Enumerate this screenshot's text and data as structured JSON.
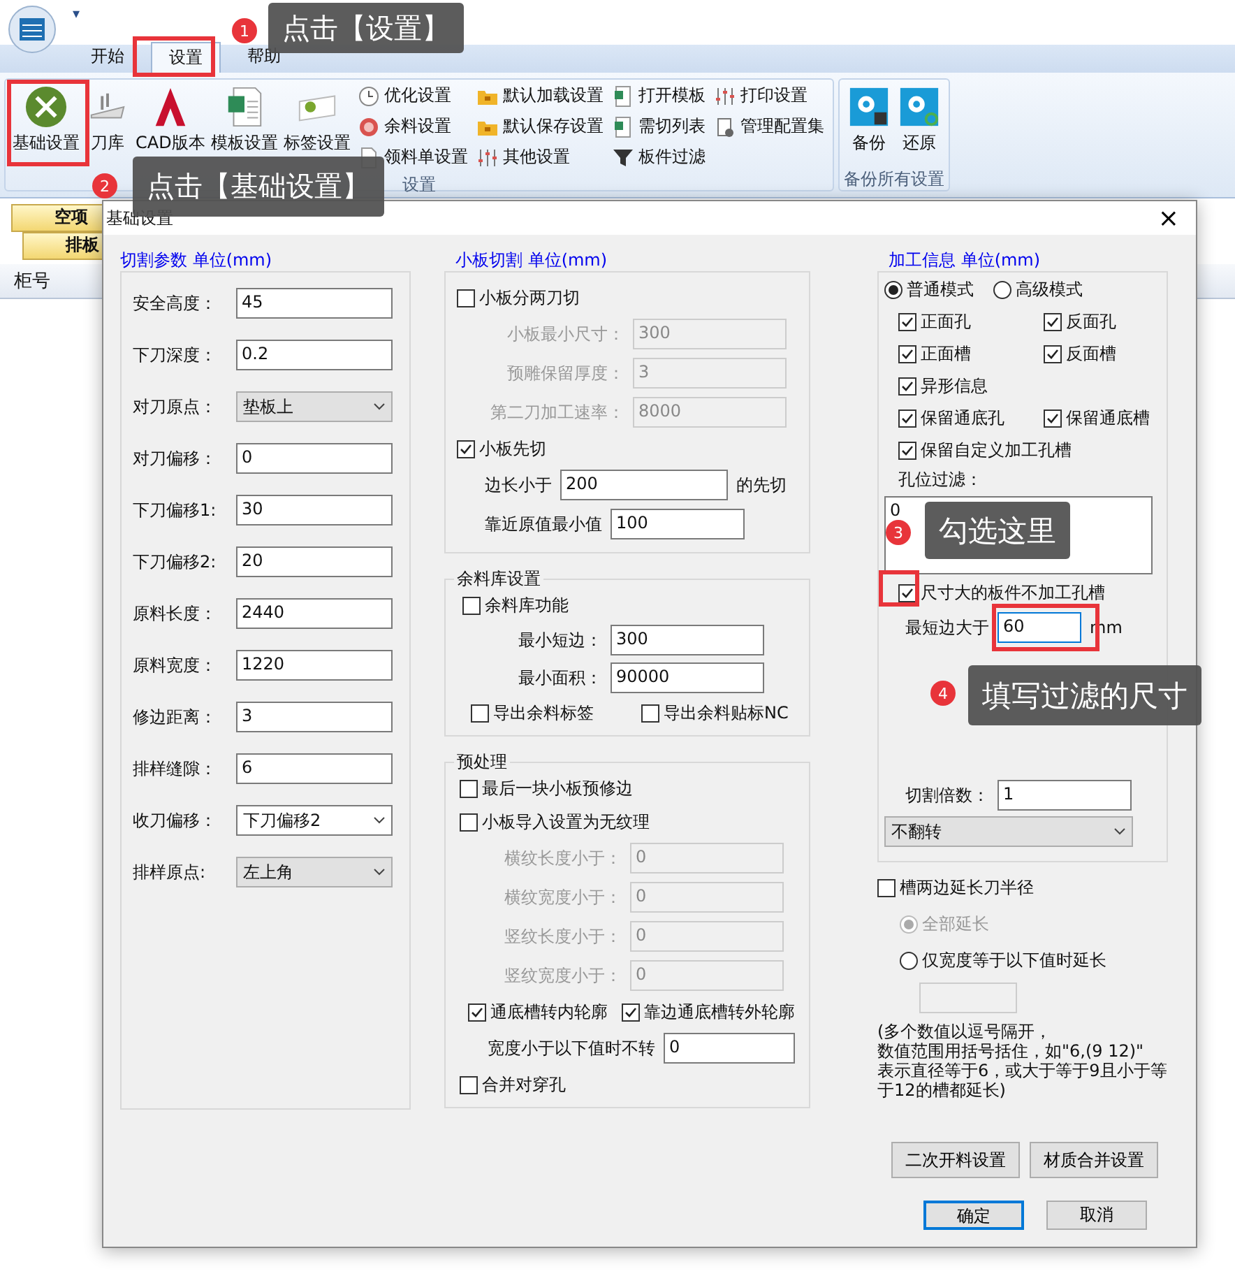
{
  "app": {
    "quick_access": "▾",
    "tabs": [
      {
        "label": "开始",
        "selected": false
      },
      {
        "label": "设置",
        "selected": true
      },
      {
        "label": "帮助",
        "selected": false
      }
    ]
  },
  "ribbon": {
    "large_buttons": [
      {
        "label": "基础设置",
        "kind": "tools"
      },
      {
        "label": "刀库",
        "kind": "knife"
      },
      {
        "label": "CAD版本",
        "kind": "cad"
      },
      {
        "label": "模板设置",
        "kind": "sheet"
      },
      {
        "label": "标签设置",
        "kind": "label"
      }
    ],
    "small_columns": [
      [
        {
          "label": "优化设置",
          "kind": "clock"
        },
        {
          "label": "余料设置",
          "kind": "coin"
        },
        {
          "label": "领料单设置",
          "kind": "doc"
        }
      ],
      [
        {
          "label": "默认加载设置",
          "kind": "folder"
        },
        {
          "label": "默认保存设置",
          "kind": "folder"
        },
        {
          "label": "其他设置",
          "kind": "sliders"
        }
      ],
      [
        {
          "label": "打开模板",
          "kind": "sheet"
        },
        {
          "label": "需切列表",
          "kind": "sheet"
        },
        {
          "label": "板件过滤",
          "kind": "funnel"
        }
      ],
      [
        {
          "label": "打印设置",
          "kind": "sliders"
        },
        {
          "label": "管理配置集",
          "kind": "gear"
        }
      ]
    ],
    "group_label": "设置",
    "backup_buttons": [
      {
        "label": "备份",
        "kind": "save"
      },
      {
        "label": "还原",
        "kind": "restore"
      }
    ],
    "backup_label": "备份所有设置"
  },
  "document": {
    "tabs": [
      "空项",
      "排板"
    ],
    "columns": [
      "柜号"
    ]
  },
  "dialog": {
    "title": "基础设置",
    "close": "×",
    "cutting": {
      "heading": "切割参数 单位(mm)",
      "rows": [
        {
          "label": "安全高度：",
          "kind": "input",
          "value": "45"
        },
        {
          "label": "下刀深度：",
          "kind": "input",
          "value": "0.2"
        },
        {
          "label": "对刀原点：",
          "kind": "select",
          "value": "垫板上"
        },
        {
          "label": "对刀偏移：",
          "kind": "input",
          "value": "0"
        },
        {
          "label": "下刀偏移1:",
          "kind": "input",
          "value": "30"
        },
        {
          "label": "下刀偏移2:",
          "kind": "input",
          "value": "20"
        },
        {
          "label": "原料长度：",
          "kind": "input",
          "value": "2440"
        },
        {
          "label": "原料宽度：",
          "kind": "input",
          "value": "1220"
        },
        {
          "label": "修边距离：",
          "kind": "input",
          "value": "3"
        },
        {
          "label": "排样缝隙：",
          "kind": "input",
          "value": "6"
        },
        {
          "label": "收刀偏移：",
          "kind": "combo",
          "value": "下刀偏移2"
        },
        {
          "label": "排样原点:",
          "kind": "select",
          "value": "左上角"
        }
      ]
    },
    "small_cut": {
      "heading": "小板切割 单位(mm)",
      "items": [
        {
          "kind": "checkbox",
          "label": "小板分两刀切",
          "checked": false
        },
        {
          "kind": "field",
          "label": "小板最小尺寸：",
          "value": "300",
          "disabled": true
        },
        {
          "kind": "field",
          "label": "预雕保留厚度：",
          "value": "3",
          "disabled": true
        },
        {
          "kind": "field",
          "label": "第二刀加工速率：",
          "value": "8000",
          "disabled": true
        },
        {
          "kind": "checkbox",
          "label": "小板先切",
          "checked": true
        },
        {
          "kind": "inline",
          "label": "边长小于",
          "value": "200",
          "suffix": "的先切"
        },
        {
          "kind": "inline",
          "label": "靠近原值最小值",
          "value": "100"
        }
      ]
    },
    "remnant": {
      "legend": "余料库设置",
      "items": [
        {
          "kind": "checkbox",
          "label": "余料库功能",
          "checked": false
        },
        {
          "kind": "field",
          "label": "最小短边：",
          "value": "300",
          "disabled": false
        },
        {
          "kind": "field",
          "label": "最小面积：",
          "value": "90000",
          "disabled": false
        },
        {
          "kind": "checkbox_pair",
          "items": [
            {
              "label": "导出余料标签",
              "checked": false
            },
            {
              "label": "导出余料贴标NC",
              "checked": false
            }
          ]
        }
      ]
    },
    "preprocess": {
      "legend": "预处理",
      "items": [
        {
          "kind": "checkbox",
          "label": "最后一块小板预修边",
          "checked": false
        },
        {
          "kind": "checkbox",
          "label": "小板导入设置为无纹理",
          "checked": false
        },
        {
          "kind": "field",
          "label": "横纹长度小于：",
          "value": "0",
          "disabled": true
        },
        {
          "kind": "field",
          "label": "横纹宽度小于：",
          "value": "0",
          "disabled": true
        },
        {
          "kind": "field",
          "label": "竖纹长度小于：",
          "value": "0",
          "disabled": true
        },
        {
          "kind": "field",
          "label": "竖纹宽度小于：",
          "value": "0",
          "disabled": true
        },
        {
          "kind": "checkbox_pair",
          "items": [
            {
              "label": "通底槽转内轮廓",
              "checked": true
            },
            {
              "label": "靠边通底槽转外轮廓",
              "checked": true
            }
          ]
        },
        {
          "kind": "inline",
          "label": "宽度小于以下值时不转",
          "value": "0"
        },
        {
          "kind": "checkbox",
          "label": "合并对穿孔",
          "checked": false
        }
      ]
    },
    "machining": {
      "heading": "加工信息 单位(mm)",
      "items": [
        {
          "kind": "radios",
          "options": [
            {
              "label": "普通模式",
              "selected": true,
              "disabled": false
            },
            {
              "label": "高级模式",
              "selected": false,
              "disabled": false
            }
          ]
        },
        {
          "kind": "checkbox_pair",
          "items": [
            {
              "label": "正面孔",
              "checked": true
            },
            {
              "label": "反面孔",
              "checked": true
            }
          ]
        },
        {
          "kind": "checkbox_pair",
          "items": [
            {
              "label": "正面槽",
              "checked": true
            },
            {
              "label": "反面槽",
              "checked": true
            }
          ]
        },
        {
          "kind": "checkbox",
          "label": "异形信息",
          "checked": true
        },
        {
          "kind": "checkbox_pair",
          "items": [
            {
              "label": "保留通底孔",
              "checked": true
            },
            {
              "label": "保留通底槽",
              "checked": true
            }
          ]
        },
        {
          "kind": "checkbox",
          "label": "保留自定义加工孔槽",
          "checked": true
        },
        {
          "kind": "text",
          "label": "孔位过滤："
        },
        {
          "kind": "listbox",
          "value": "0"
        },
        {
          "kind": "checkbox",
          "label": "尺寸大的板件不加工孔槽",
          "checked": true
        },
        {
          "kind": "inline",
          "label": "最短边大于",
          "value": "60",
          "suffix": "mm",
          "focused": true
        },
        {
          "kind": "spacer"
        },
        {
          "kind": "inline",
          "label": "切割倍数：",
          "value": "1"
        },
        {
          "kind": "select",
          "value": "不翻转"
        }
      ]
    },
    "extend": {
      "items": [
        {
          "kind": "checkbox",
          "label": "槽两边延长刀半径",
          "checked": false
        },
        {
          "kind": "radios",
          "options": [
            {
              "label": "全部延长",
              "selected": true,
              "disabled": true
            }
          ]
        },
        {
          "kind": "radios",
          "options": [
            {
              "label": "仅宽度等于以下值时延长",
              "selected": false,
              "disabled": false
            }
          ]
        },
        {
          "kind": "blank_input"
        },
        {
          "kind": "note",
          "lines": [
            "(多个数值以逗号隔开，",
            "数值范围用括号括住，如\"6,(9 12)\"",
            "表示直径等于6，或大于等于9且小于等",
            "于12的槽都延长)"
          ]
        }
      ]
    },
    "side_buttons": [
      "二次开料设置",
      "材质合并设置"
    ],
    "buttons": [
      {
        "label": "确定",
        "default": true
      },
      {
        "label": "取消",
        "default": false
      }
    ]
  },
  "annotations": [
    {
      "number": "1",
      "text": "点击【设置】"
    },
    {
      "number": "2",
      "text": "点击【基础设置】"
    },
    {
      "number": "3",
      "text": "勾选这里"
    },
    {
      "number": "4",
      "text": "填写过滤的尺寸"
    }
  ]
}
